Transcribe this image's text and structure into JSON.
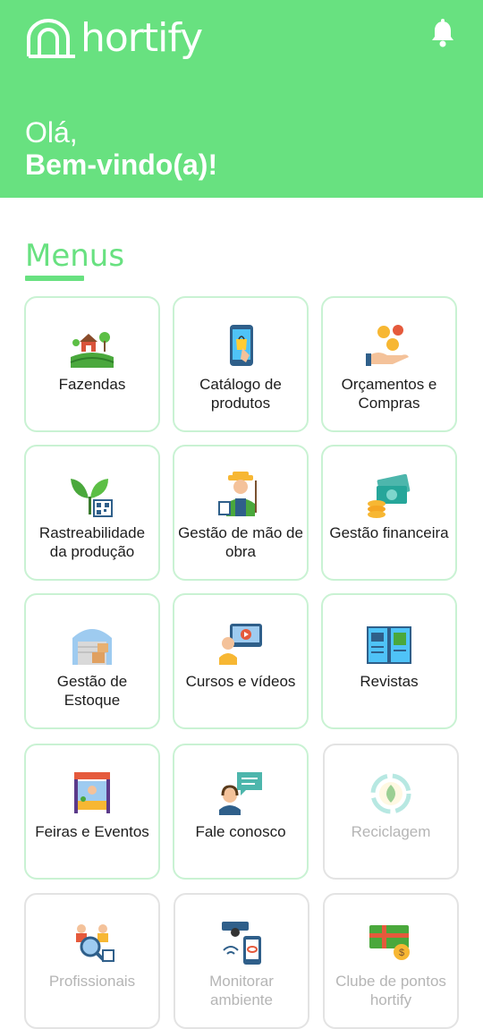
{
  "header": {
    "logo_text": "hortify",
    "greeting": "Olá,",
    "welcome": "Bem-vindo(a)!"
  },
  "menus": {
    "title": "Menus",
    "items": [
      {
        "label": "Fazendas",
        "icon": "farm-icon",
        "enabled": true
      },
      {
        "label": "Catálogo de produtos",
        "icon": "mobile-shop-icon",
        "enabled": true
      },
      {
        "label": "Orçamentos e Compras",
        "icon": "money-hand-icon",
        "enabled": true
      },
      {
        "label": "Rastreabilidade da produção",
        "icon": "plant-qr-icon",
        "enabled": true
      },
      {
        "label": "Gestão de mão de obra",
        "icon": "farmer-icon",
        "enabled": true
      },
      {
        "label": "Gestão financeira",
        "icon": "cash-coins-icon",
        "enabled": true
      },
      {
        "label": "Gestão de Estoque",
        "icon": "warehouse-icon",
        "enabled": true
      },
      {
        "label": "Cursos e vídeos",
        "icon": "video-course-icon",
        "enabled": true
      },
      {
        "label": "Revistas",
        "icon": "magazine-icon",
        "enabled": true
      },
      {
        "label": "Feiras e Eventos",
        "icon": "market-stall-icon",
        "enabled": true
      },
      {
        "label": "Fale conosco",
        "icon": "chat-person-icon",
        "enabled": true
      },
      {
        "label": "Reciclagem",
        "icon": "recycle-icon",
        "enabled": false
      },
      {
        "label": "Profissionais",
        "icon": "professionals-icon",
        "enabled": false
      },
      {
        "label": "Monitorar ambiente",
        "icon": "camera-monitor-icon",
        "enabled": false
      },
      {
        "label": "Clube de pontos hortify",
        "icon": "gift-card-icon",
        "enabled": false
      }
    ]
  },
  "colors": {
    "brand": "#68e180",
    "card_border": "#c9f2d3",
    "disabled_text": "#b5b5b5"
  }
}
